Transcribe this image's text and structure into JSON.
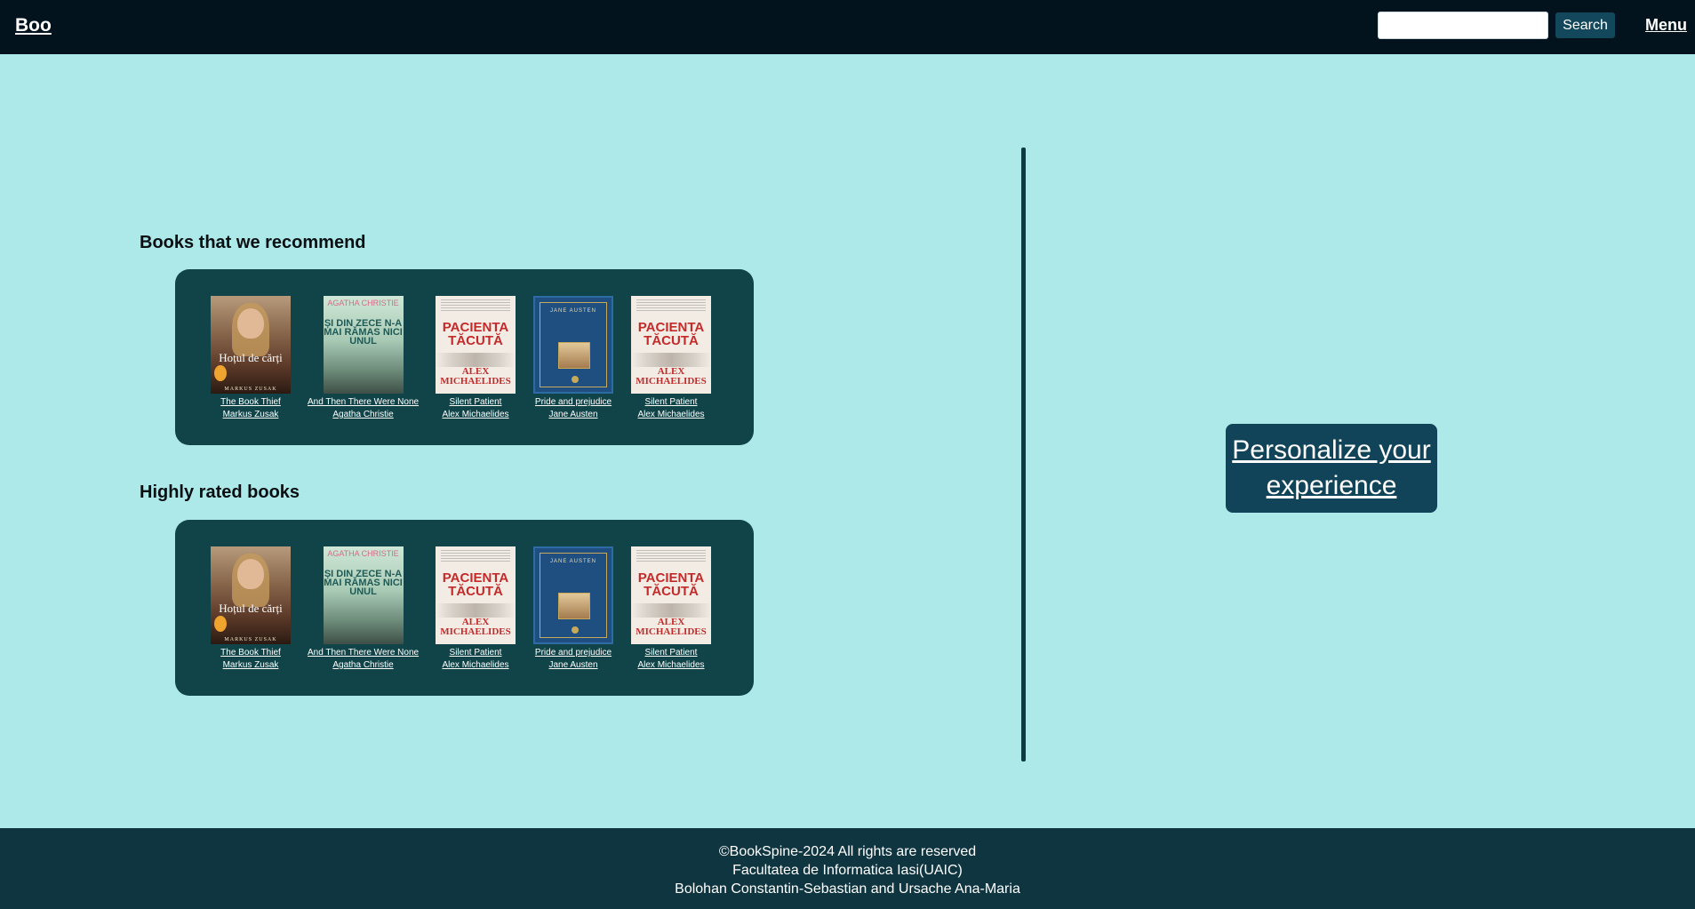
{
  "header": {
    "brand": "Boo",
    "search_placeholder": "",
    "search_label": "Search",
    "menu_label": "Menu"
  },
  "recommended": {
    "title": "Books that we recommend",
    "books": [
      {
        "title": "The Book Thief",
        "author": "Markus Zusak",
        "cover": {
          "text1": "Hoțul de cărți",
          "text2": "MARKUS ZUSAK"
        }
      },
      {
        "title": "And Then There Were None",
        "author": "Agatha Christie",
        "cover": {
          "text1": "AGATHA CHRISTIE",
          "text2": "ȘI DIN ZECE N-A MAI RĂMAS NICI UNUL"
        }
      },
      {
        "title": "Silent Patient",
        "author": "Alex Michaelides",
        "cover": {
          "text1": "PACIENTA TĂCUTĂ",
          "text2": "ALEX MICHAELIDES"
        }
      },
      {
        "title": "Pride and prejudice",
        "author": "Jane Austen",
        "cover": {
          "text1": "JANE AUSTEN"
        }
      },
      {
        "title": "Silent Patient",
        "author": "Alex Michaelides",
        "cover": {
          "text1": "PACIENTA TĂCUTĂ",
          "text2": "ALEX MICHAELIDES"
        }
      }
    ]
  },
  "rated": {
    "title": "Highly rated books",
    "books": [
      {
        "title": "The Book Thief",
        "author": "Markus Zusak",
        "cover": {
          "text1": "Hoțul de cărți",
          "text2": "MARKUS ZUSAK"
        }
      },
      {
        "title": "And Then There Were None",
        "author": "Agatha Christie",
        "cover": {
          "text1": "AGATHA CHRISTIE",
          "text2": "ȘI DIN ZECE N-A MAI RĂMAS NICI UNUL"
        }
      },
      {
        "title": "Silent Patient",
        "author": "Alex Michaelides",
        "cover": {
          "text1": "PACIENTA TĂCUTĂ",
          "text2": "ALEX MICHAELIDES"
        }
      },
      {
        "title": "Pride and prejudice",
        "author": "Jane Austen",
        "cover": {
          "text1": "JANE AUSTEN"
        }
      },
      {
        "title": "Silent Patient",
        "author": "Alex Michaelides",
        "cover": {
          "text1": "PACIENTA TĂCUTĂ",
          "text2": "ALEX MICHAELIDES"
        }
      }
    ]
  },
  "personalize_label": "Personalize your experience",
  "footer": {
    "line1": "©BookSpine-2024 All rights are reserved",
    "line2": "Facultatea de Informatica Iasi(UAIC)",
    "line3": "Bolohan Constantin-Sebastian and Ursache Ana-Maria"
  },
  "colors": {
    "page_bg": "#aee9ea",
    "header_bg": "#03131d",
    "shelf_bg": "#104448",
    "button_bg": "#114459",
    "footer_bg": "#0f3540"
  }
}
